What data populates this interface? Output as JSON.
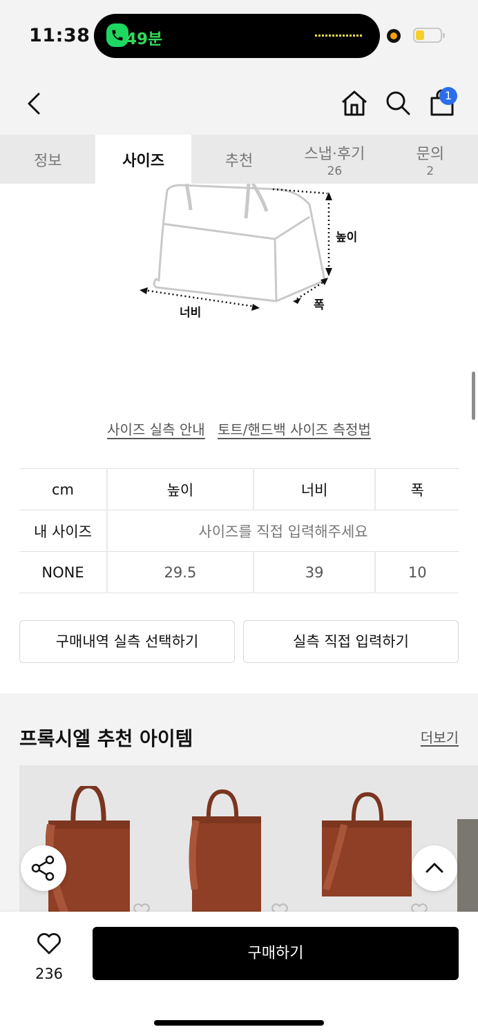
{
  "status_bar": {
    "time": "11:38",
    "call_duration": "49분",
    "icons": [
      "phone-call-icon",
      "recording-dot-icon",
      "battery-icon"
    ]
  },
  "nav": {
    "icons": [
      "back-icon",
      "home-icon",
      "search-icon",
      "cart-icon"
    ],
    "cart_badge": "1"
  },
  "tabs": [
    {
      "label": "정보",
      "count": ""
    },
    {
      "label": "사이즈",
      "count": ""
    },
    {
      "label": "추천",
      "count": ""
    },
    {
      "label": "스냅·후기",
      "count": "26"
    },
    {
      "label": "문의",
      "count": "2"
    }
  ],
  "diagram": {
    "height_label": "높이",
    "width_label": "너비",
    "depth_label": "폭"
  },
  "size_links": {
    "guide": "사이즈 실측 안내",
    "method": "토트/핸드백 사이즈 측정법"
  },
  "size_table": {
    "headers": [
      "cm",
      "높이",
      "너비",
      "폭"
    ],
    "my_size_label": "내 사이즈",
    "my_size_placeholder": "사이즈를 직접 입력해주세요",
    "rows": [
      {
        "name": "NONE",
        "values": [
          "29.5",
          "39",
          "10"
        ]
      }
    ]
  },
  "buttons": {
    "select_from_history": "구매내역 실측 선택하기",
    "direct_input": "실측 직접 입력하기"
  },
  "recommend": {
    "title": "프록시엘 추천 아이템",
    "more": "더보기"
  },
  "bottom_bar": {
    "like_count": "236",
    "buy_label": "구매하기"
  },
  "colors": {
    "accent_badge": "#2c6ee9",
    "call_green": "#31d95b",
    "bag_brown": "#8e3f25"
  }
}
